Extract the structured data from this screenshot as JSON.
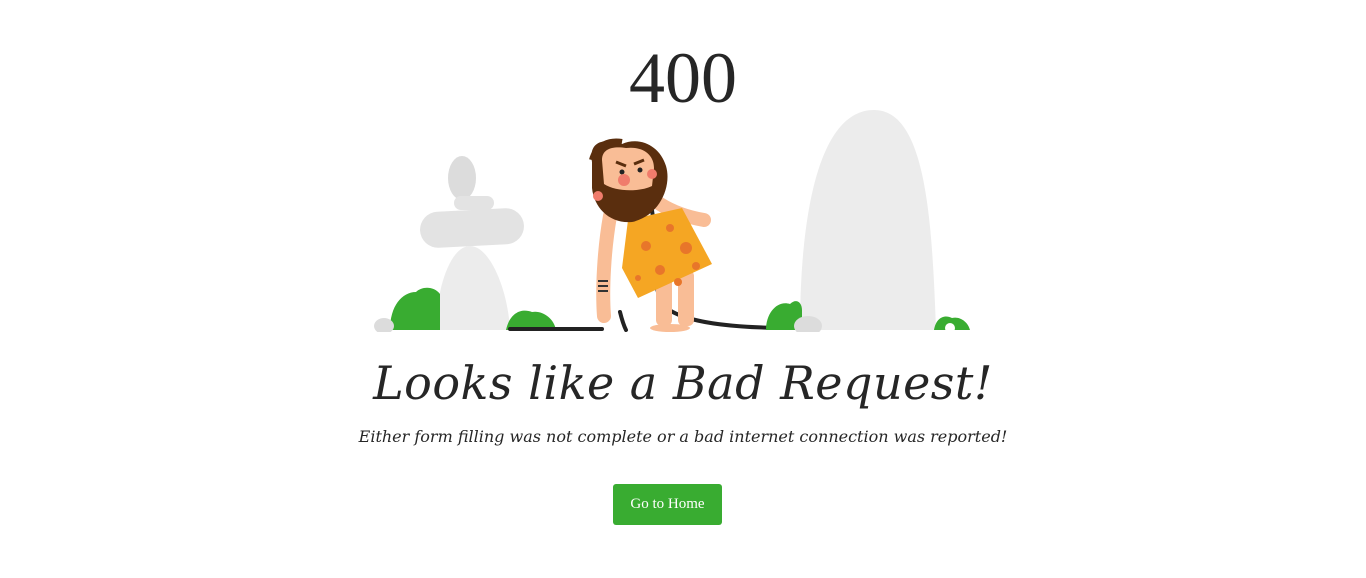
{
  "error": {
    "code": "400",
    "headline": "Looks like a Bad Request!",
    "message": "Either form filling was not complete or a bad internet connection was reported!"
  },
  "actions": {
    "home_label": "Go to Home"
  },
  "colors": {
    "button": "#39ac31",
    "text": "#262626",
    "stone": "#ececec",
    "bush": "#39ac31",
    "tunic": "#f5a623",
    "hair": "#5a2e0e",
    "skin": "#f9bd96"
  }
}
